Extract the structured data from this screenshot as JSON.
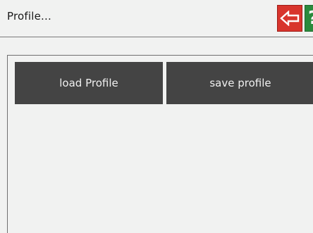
{
  "header": {
    "title": "Profile...",
    "back_icon": "back-arrow-icon",
    "back_color": "#d8352d",
    "help_label": "?",
    "help_color": "#2b8a3d"
  },
  "actions": {
    "load_label": "load Profile",
    "save_label": "save profile",
    "button_color": "#444444"
  }
}
